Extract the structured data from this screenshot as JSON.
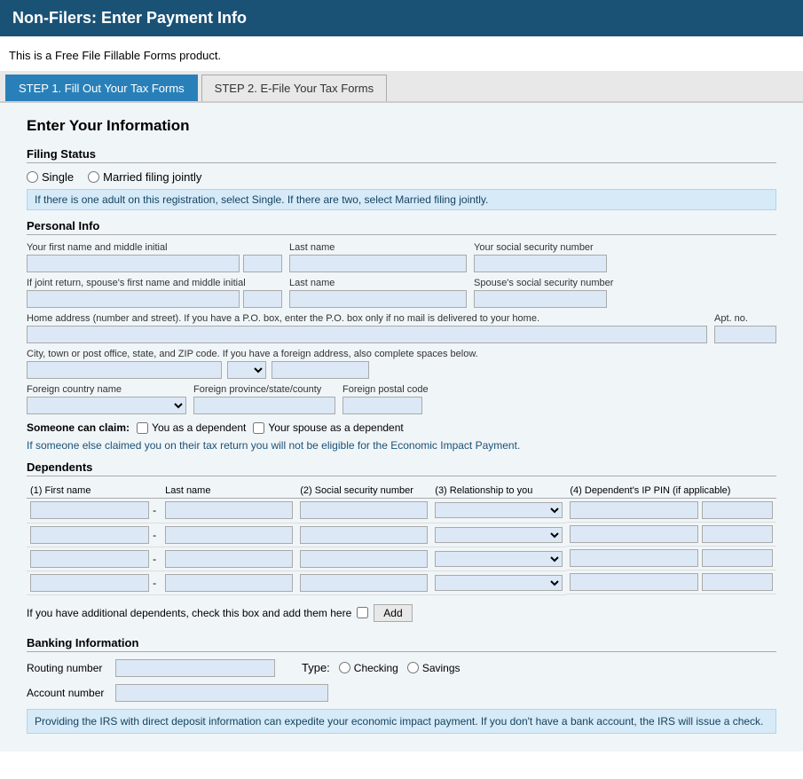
{
  "header": {
    "title": "Non-Filers: Enter Payment Info"
  },
  "subtitle": "This is a Free File Fillable Forms product.",
  "tabs": [
    {
      "id": "step1",
      "label": "STEP 1. Fill Out Your Tax Forms",
      "active": true
    },
    {
      "id": "step2",
      "label": "STEP 2. E-File Your Tax Forms",
      "active": false
    }
  ],
  "form": {
    "section_title": "Enter Your Information",
    "filing_status": {
      "subsection": "Filing Status",
      "options": [
        "Single",
        "Married filing jointly"
      ],
      "info_text": "If there is one adult on this registration, select Single. If there are two, select Married filing jointly."
    },
    "personal_info": {
      "subsection": "Personal Info",
      "fields": {
        "first_name_label": "Your first name and middle initial",
        "last_name_label": "Last name",
        "ssn_label": "Your social security number",
        "spouse_first_label": "If joint return, spouse's first name and middle initial",
        "spouse_last_label": "Last name",
        "spouse_ssn_label": "Spouse's social security number",
        "home_address_label": "Home address (number and street). If you have a P.O. box, enter the P.O. box only if no mail is delivered to your home.",
        "apt_label": "Apt. no.",
        "city_label": "City, town or post office, state, and ZIP code. If you have a foreign address, also complete spaces below.",
        "foreign_country_label": "Foreign country name",
        "foreign_province_label": "Foreign province/state/county",
        "foreign_postal_label": "Foreign postal code"
      }
    },
    "someone_claim": {
      "label": "Someone can claim:",
      "option1": "You as a dependent",
      "option2": "Your spouse as a dependent",
      "warning": "If someone else claimed you on their tax return you will not be eligible for the Economic Impact Payment."
    },
    "dependents": {
      "subsection": "Dependents",
      "columns": [
        "(1) First name",
        "Last name",
        "(2) Social security number",
        "(3) Relationship to you",
        "(4) Dependent's IP PIN (if applicable)"
      ],
      "rows": 4,
      "add_text": "If you have additional dependents, check this box and add them here",
      "add_button": "Add"
    },
    "banking": {
      "subsection": "Banking Information",
      "routing_label": "Routing number",
      "account_label": "Account number",
      "type_label": "Type:",
      "type_options": [
        "Checking",
        "Savings"
      ],
      "info_text": "Providing the IRS with direct deposit information can expedite your economic impact payment. If you don't have a bank account, the IRS will issue a check."
    }
  }
}
